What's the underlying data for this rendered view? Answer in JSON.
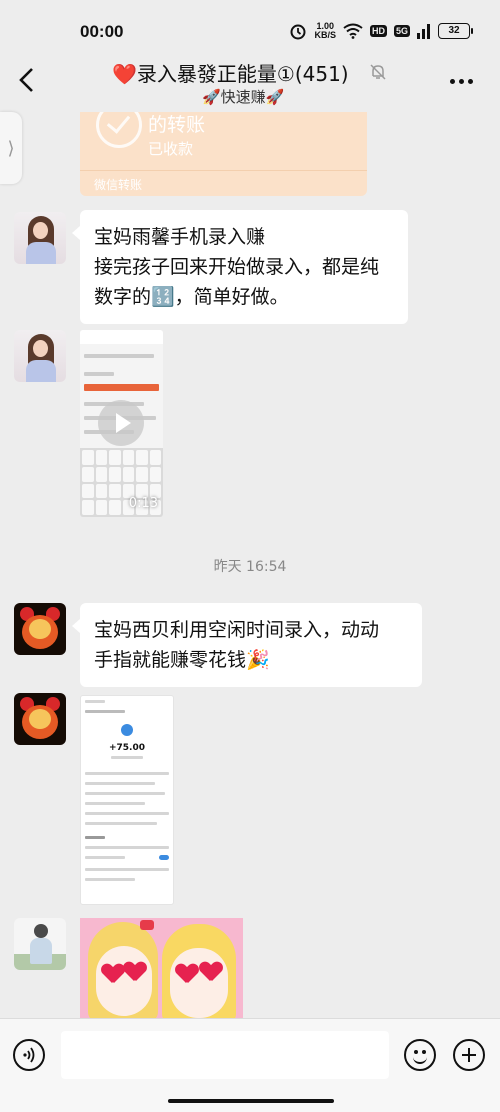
{
  "status_bar": {
    "time": "00:00",
    "net_speed_value": "1.00",
    "net_speed_unit": "KB/S",
    "hd_badge": "HD",
    "signal_badge": "5G",
    "battery": "32",
    "icons": [
      "alarm-icon",
      "wifi-icon",
      "signal-icon",
      "battery-icon"
    ]
  },
  "header": {
    "title": "❤️录入暴發正能量①(451)",
    "subtitle": "🚀快速赚🚀",
    "icons": [
      "back-icon",
      "mute-bell-icon",
      "more-icon"
    ]
  },
  "messages": {
    "transfer": {
      "title": "的转账",
      "status": "已收款",
      "footer": "微信转账"
    },
    "msg1": {
      "line1": "宝妈雨馨手机录入赚",
      "line2": "接完孩子回来开始做录入，都是纯",
      "line3": "数字的🔢，简单好做。"
    },
    "video": {
      "duration": "0:13"
    },
    "timestamp": "昨天 16:54",
    "msg2": {
      "line1": "宝妈西贝利用空闲时间录入，动动",
      "line2": "手指就能赚零花钱🎉"
    },
    "screenshot": {
      "amount": "+75.00"
    }
  },
  "input_bar": {
    "placeholder": "",
    "icons": [
      "voice-icon",
      "emoji-icon",
      "plus-icon"
    ]
  },
  "colors": {
    "background": "#ededed",
    "bubble": "#ffffff",
    "transfer_card": "#fbe1c9",
    "accent_orange": "#e8643a"
  }
}
